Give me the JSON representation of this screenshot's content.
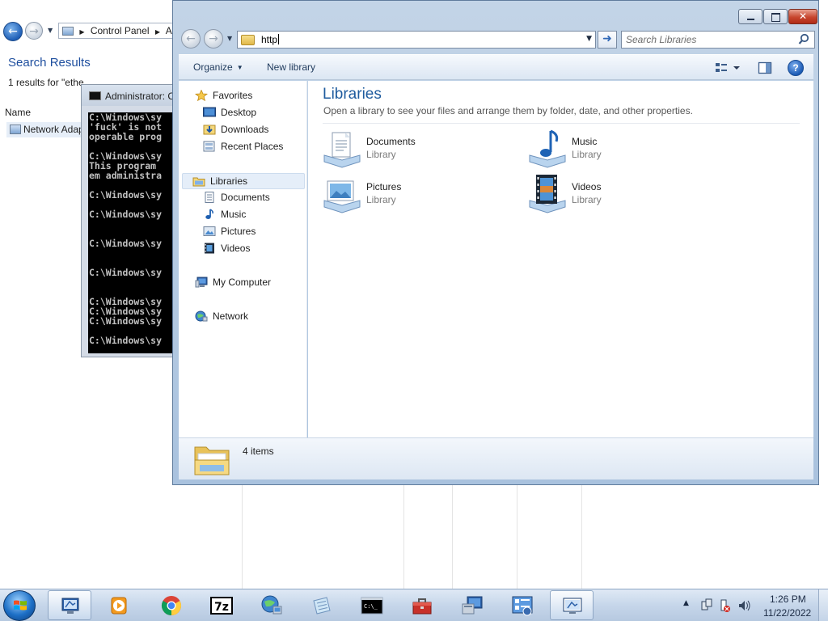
{
  "background_window": {
    "breadcrumb": [
      "Control Panel",
      "A"
    ],
    "title": "Search Results",
    "result_count": "1 results for \"ethe",
    "column_name": "Name",
    "row_label": "Network Adap"
  },
  "cmd_window": {
    "title": "Administrator: C",
    "lines": [
      "C:\\Windows\\sy",
      "'fuck' is not",
      "operable prog",
      "",
      "C:\\Windows\\sy",
      "This program",
      "em administra",
      "",
      "C:\\Windows\\sy",
      "",
      "C:\\Windows\\sy",
      "",
      "",
      "C:\\Windows\\sy",
      "",
      "",
      "C:\\Windows\\sy",
      "",
      "",
      "C:\\Windows\\sy",
      "C:\\Windows\\sy",
      "C:\\Windows\\sy",
      "",
      "C:\\Windows\\sy"
    ]
  },
  "explorer": {
    "address_value": "http",
    "search_placeholder": "Search Libraries",
    "toolbar": {
      "organize_label": "Organize",
      "new_library_label": "New library"
    },
    "nav": {
      "favorites": "Favorites",
      "desktop": "Desktop",
      "downloads": "Downloads",
      "recent_places": "Recent Places",
      "libraries": "Libraries",
      "documents": "Documents",
      "music": "Music",
      "pictures": "Pictures",
      "videos": "Videos",
      "my_computer": "My Computer",
      "network": "Network"
    },
    "content": {
      "title": "Libraries",
      "subtitle": "Open a library to see your files and arrange them by folder, date, and other properties.",
      "libraries": [
        {
          "name": "Documents",
          "type": "Library",
          "icon": "documents-library-icon"
        },
        {
          "name": "Music",
          "type": "Library",
          "icon": "music-library-icon"
        },
        {
          "name": "Pictures",
          "type": "Library",
          "icon": "pictures-library-icon"
        },
        {
          "name": "Videos",
          "type": "Library",
          "icon": "videos-library-icon"
        }
      ]
    },
    "details": {
      "item_count": "4 items"
    }
  },
  "taskbar": {
    "apps": [
      "control-panel-icon",
      "media-player-icon",
      "chrome-icon",
      "7zip-icon",
      "network-globe-icon",
      "notepad-icon",
      "cmd-icon",
      "toolbox-icon",
      "computer-icon",
      "settings-panel-icon",
      "explorer-icon"
    ],
    "clock_time": "1:26 PM",
    "clock_date": "11/22/2022"
  },
  "colors": {
    "accent": "#1e5b9e",
    "window_frame": "#a9c2de",
    "close_button": "#c7462e",
    "selection": "#e5eef9"
  }
}
